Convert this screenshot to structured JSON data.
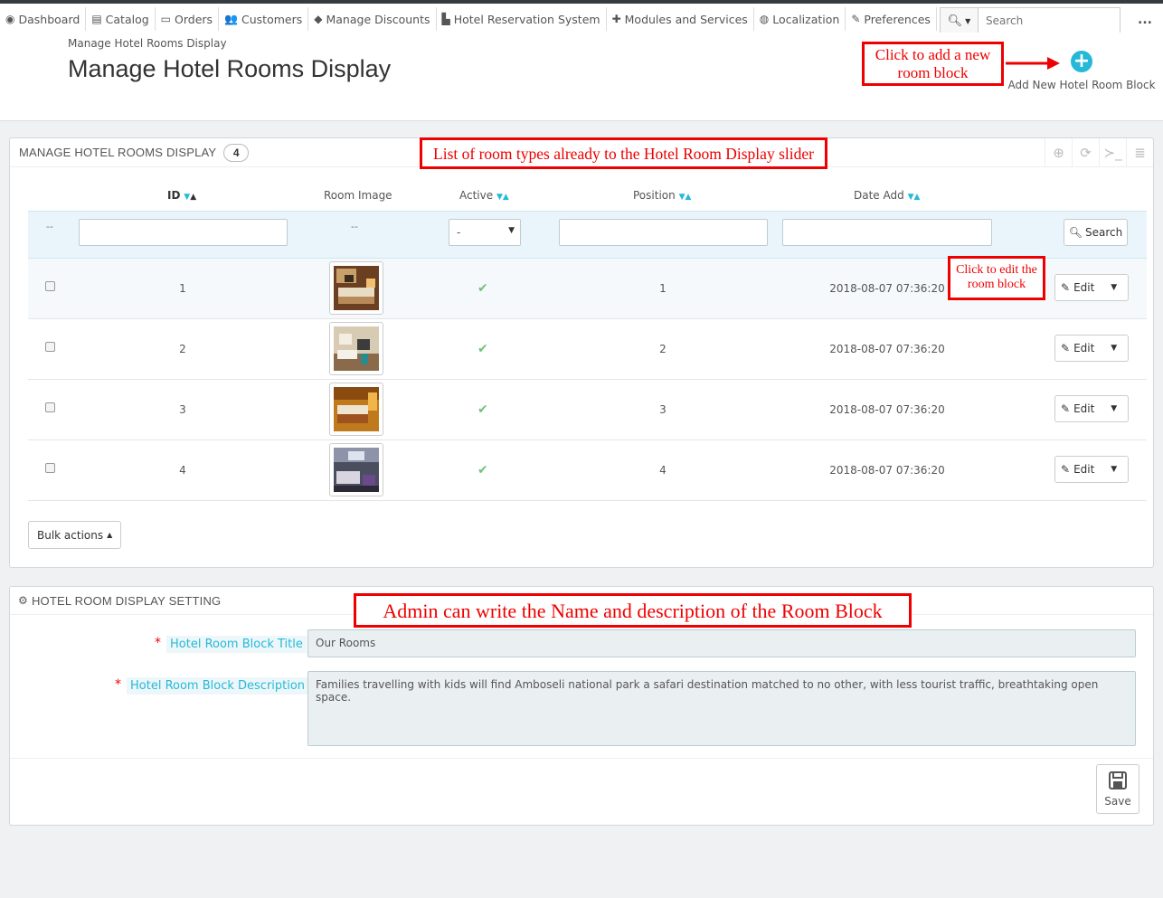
{
  "nav": {
    "items": [
      {
        "label": "Dashboard",
        "icon": "dashboard-icon",
        "glyph": "◉"
      },
      {
        "label": "Catalog",
        "icon": "book-icon",
        "glyph": "▤"
      },
      {
        "label": "Orders",
        "icon": "credit-card-icon",
        "glyph": "▭"
      },
      {
        "label": "Customers",
        "icon": "users-icon",
        "glyph": "👥"
      },
      {
        "label": "Manage Discounts",
        "icon": "tag-icon",
        "glyph": "◆"
      },
      {
        "label": "Hotel Reservation System",
        "icon": "bed-icon",
        "glyph": "▙"
      },
      {
        "label": "Modules and Services",
        "icon": "puzzle-icon",
        "glyph": "✚"
      },
      {
        "label": "Localization",
        "icon": "globe-icon",
        "glyph": "◍"
      },
      {
        "label": "Preferences",
        "icon": "wrench-icon",
        "glyph": "✎"
      }
    ],
    "search_placeholder": "Search",
    "more": "..."
  },
  "header": {
    "breadcrumb": "Manage Hotel Rooms Display",
    "title": "Manage Hotel Rooms Display",
    "add_label": "Add New Hotel Room Block"
  },
  "annotations": {
    "add": "Click to add a new room block",
    "list": "List of room types already to the Hotel Room Display slider",
    "edit": "Click to edit the room block",
    "form": "Admin can write the Name and description of the Room Block"
  },
  "list_panel": {
    "title": "MANAGE HOTEL ROOMS DISPLAY",
    "count": "4",
    "columns": {
      "id": "ID",
      "image": "Room Image",
      "active": "Active",
      "position": "Position",
      "date": "Date Add"
    },
    "filter": {
      "dash": "--",
      "select_value": "-",
      "search_label": "Search"
    },
    "rows": [
      {
        "id": "1",
        "position": "1",
        "date": "2018-08-07 07:36:20",
        "edit": "Edit"
      },
      {
        "id": "2",
        "position": "2",
        "date": "2018-08-07 07:36:20",
        "edit": "Edit"
      },
      {
        "id": "3",
        "position": "3",
        "date": "2018-08-07 07:36:20",
        "edit": "Edit"
      },
      {
        "id": "4",
        "position": "4",
        "date": "2018-08-07 07:36:20",
        "edit": "Edit"
      }
    ],
    "bulk_label": "Bulk actions"
  },
  "settings_panel": {
    "title": "HOTEL ROOM DISPLAY SETTING",
    "title_label": "Hotel Room Block Title",
    "title_value": "Our Rooms",
    "desc_label": "Hotel Room Block Description",
    "desc_value": "Families travelling with kids will find Amboseli national park a safari destination matched to no other, with less tourist traffic, breathtaking open space.",
    "save_label": "Save"
  },
  "colors": {
    "accent": "#25b9d7",
    "annotation": "#ee0000",
    "active_check": "#72c279"
  }
}
